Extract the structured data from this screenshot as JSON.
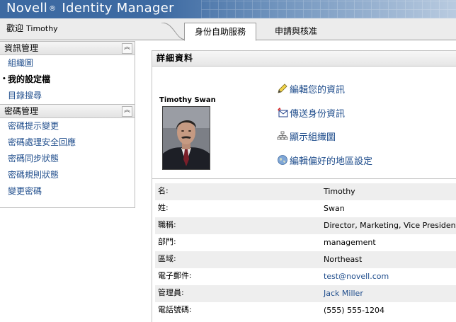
{
  "header": {
    "brand": "Novell",
    "reg": "®",
    "product": "Identity Manager"
  },
  "welcome": {
    "label": "歡迎",
    "user": "Timothy"
  },
  "tabs": [
    {
      "label": "身份自助服務",
      "active": true
    },
    {
      "label": "申請與核准",
      "active": false
    }
  ],
  "nav": {
    "section1": {
      "title": "資訊管理",
      "items": [
        "組織圖",
        "我的設定檔",
        "目錄搜尋"
      ],
      "current": 1
    },
    "section2": {
      "title": "密碼管理",
      "items": [
        "密碼提示變更",
        "密碼處理安全回應",
        "密碼同步狀態",
        "密碼規則狀態",
        "變更密碼"
      ]
    }
  },
  "detail": {
    "title": "詳細資料",
    "person_name": "Timothy Swan",
    "actions": [
      "編輯您的資訊",
      "傳送身份資訊",
      "顯示組織圖",
      "編輯偏好的地區設定"
    ],
    "fields": [
      {
        "label": "名:",
        "value": "Timothy",
        "link": false
      },
      {
        "label": "姓:",
        "value": "Swan",
        "link": false
      },
      {
        "label": "職稱:",
        "value": "Director, Marketing, Vice President",
        "link": false
      },
      {
        "label": "部門:",
        "value": "management",
        "link": false
      },
      {
        "label": "區域:",
        "value": "Northeast",
        "link": false
      },
      {
        "label": "電子郵件:",
        "value": "test@novell.com",
        "link": true
      },
      {
        "label": "管理員:",
        "value": "Jack Miller",
        "link": true
      },
      {
        "label": "電話號碼:",
        "value": "(555) 555-1204",
        "link": false
      }
    ]
  },
  "colors": {
    "brand_blue": "#3d6aa2",
    "link": "#1f4d8c"
  },
  "icons": [
    "pencil-icon",
    "envelope-icon",
    "org-chart-icon",
    "globe-icon",
    "collapse-up-icon"
  ]
}
